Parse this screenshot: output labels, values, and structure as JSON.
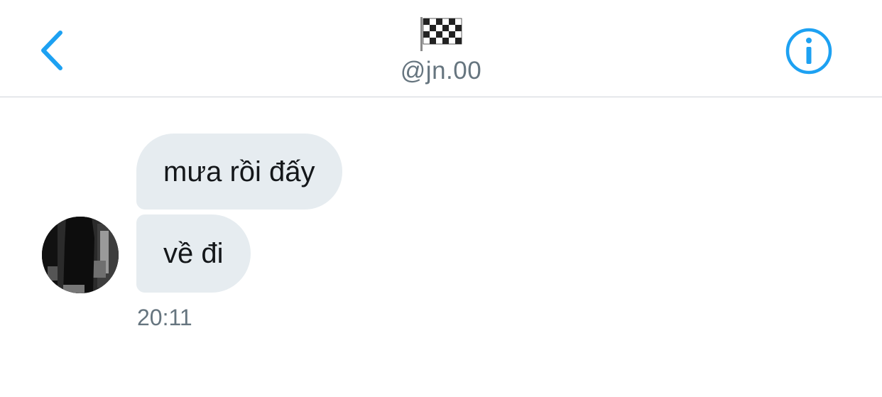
{
  "header": {
    "flag_icon": "checkered-flag-icon",
    "handle": "@jn.00",
    "back_icon": "chevron-left-icon",
    "info_icon": "info-circle-icon",
    "accent_color": "#1da1f2"
  },
  "conversation": {
    "messages": [
      {
        "text": "mưa rồi đấy"
      },
      {
        "text": "về đi"
      }
    ],
    "timestamp": "20:11",
    "bubble_color": "#e6ecf0",
    "meta_color": "#66757f"
  }
}
